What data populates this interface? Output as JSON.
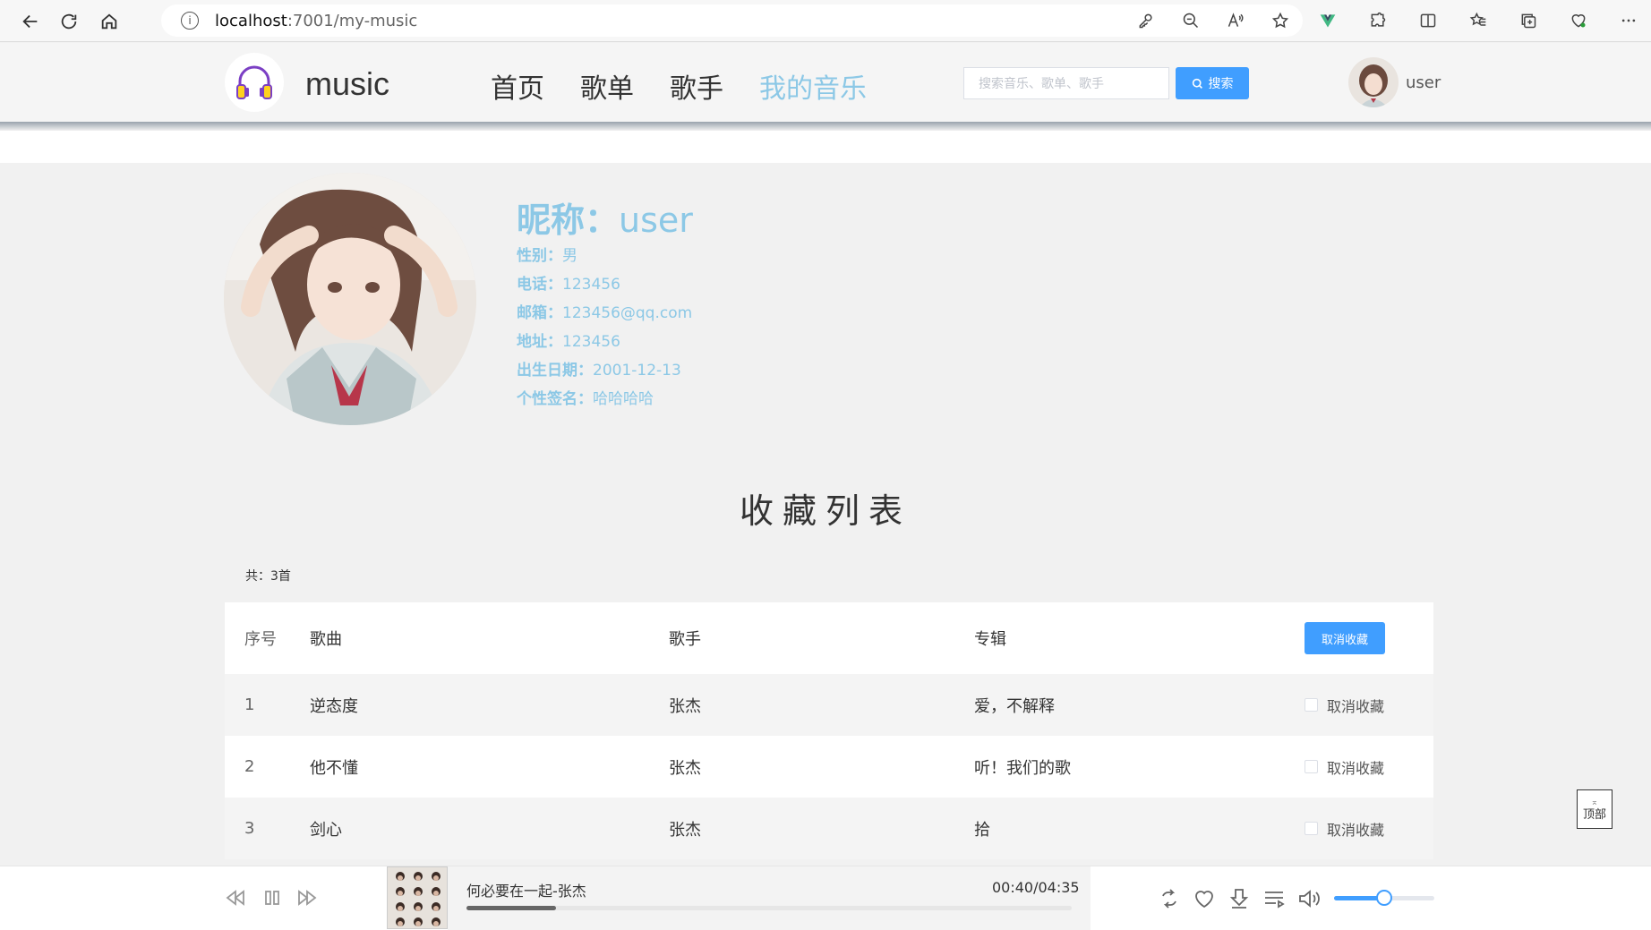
{
  "browser": {
    "url_host": "localhost",
    "url_path": ":7001/my-music"
  },
  "header": {
    "logo_text": "music",
    "nav": [
      "首页",
      "歌单",
      "歌手",
      "我的音乐"
    ],
    "active_nav": "我的音乐",
    "search_placeholder": "搜索音乐、歌单、歌手",
    "search_button": "搜索",
    "username": "user"
  },
  "profile": {
    "nickname_label": "昵称：",
    "nickname": "user",
    "gender_label": "性别：",
    "gender": "男",
    "phone_label": "电话：",
    "phone": "123456",
    "email_label": "邮箱：",
    "email": "123456@qq.com",
    "address_label": "地址：",
    "address": "123456",
    "birthday_label": "出生日期：",
    "birthday": "2001-12-13",
    "signature_label": "个性签名：",
    "signature": "哈哈哈哈"
  },
  "favorites": {
    "title": "收藏列表",
    "count": "共：3首",
    "columns": {
      "index": "序号",
      "song": "歌曲",
      "singer": "歌手",
      "album": "专辑",
      "action": "取消收藏"
    },
    "rows": [
      {
        "index": "1",
        "song": "逆态度",
        "singer": "张杰",
        "album": "爱，不解释",
        "action": "取消收藏"
      },
      {
        "index": "2",
        "song": "他不懂",
        "singer": "张杰",
        "album": "听！我们的歌",
        "action": "取消收藏"
      },
      {
        "index": "3",
        "song": "剑心",
        "singer": "张杰",
        "album": "拾",
        "action": "取消收藏"
      }
    ]
  },
  "top_button": {
    "arrow": "⌅",
    "label": "顶部"
  },
  "player": {
    "song": "何必要在一起-张杰",
    "time": "00:40/04:35",
    "progress": 0.148,
    "volume": 0.5
  },
  "colors": {
    "accent": "#8cc8e6",
    "primary": "#409eff"
  }
}
